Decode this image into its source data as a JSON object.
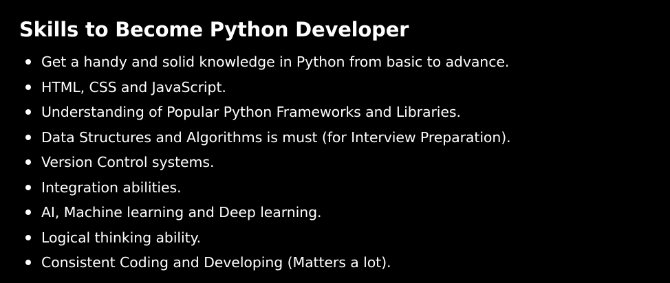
{
  "heading": "Skills to Become Python Developer",
  "skills": [
    "Get a handy and solid knowledge in Python from basic to advance.",
    "HTML, CSS and JavaScript.",
    "Understanding of Popular Python Frameworks and Libraries.",
    "Data Structures and Algorithms is must (for Interview Preparation).",
    "Version Control systems.",
    "Integration abilities.",
    "AI, Machine learning and Deep learning.",
    "Logical thinking ability.",
    "Consistent Coding and Developing (Matters a lot)."
  ],
  "colors": {
    "background": "#000000",
    "text": "#ffffff"
  }
}
